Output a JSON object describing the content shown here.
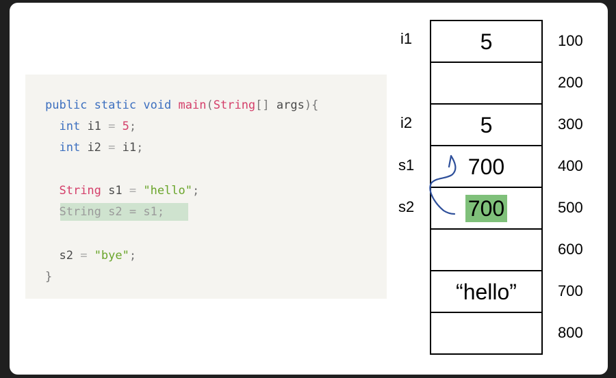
{
  "code": {
    "line1": {
      "kw1": "public",
      "kw2": "static",
      "kw3": "void",
      "fn": "main",
      "p1": "(",
      "type": "String",
      "p2": "[]",
      "args": " args",
      "p3": "){"
    },
    "line2": {
      "kw": "int",
      "name": " i1 ",
      "op": "=",
      "val": " 5",
      ";": ";"
    },
    "line3": {
      "kw": "int",
      "name": " i2 ",
      "op": "=",
      "val": " i1",
      ";": ";"
    },
    "line4": {
      "type": "String",
      "name": " s1 ",
      "op": "=",
      "val": " \"hello\"",
      "end": ";"
    },
    "line5": {
      "type": "String",
      "name": " s2 ",
      "op": "=",
      "val": " s1",
      "end": ";"
    },
    "line6": {
      "name": "s2 ",
      "op": "=",
      "val": " \"bye\"",
      "end": ";"
    },
    "line7": {
      "brace": "}"
    }
  },
  "memory": {
    "cells": [
      {
        "value": "5",
        "address": "100",
        "var": "i1"
      },
      {
        "value": "",
        "address": "200",
        "var": ""
      },
      {
        "value": "5",
        "address": "300",
        "var": "i2"
      },
      {
        "value": "700",
        "address": "400",
        "var": "s1"
      },
      {
        "value": "700",
        "address": "500",
        "var": "s2",
        "highlight": true
      },
      {
        "value": "",
        "address": "600",
        "var": ""
      },
      {
        "value": "“hello”",
        "address": "700",
        "var": ""
      },
      {
        "value": "",
        "address": "800",
        "var": ""
      }
    ]
  },
  "colors": {
    "highlight": "#7fc07a",
    "arrow": "#2e4f9a"
  }
}
